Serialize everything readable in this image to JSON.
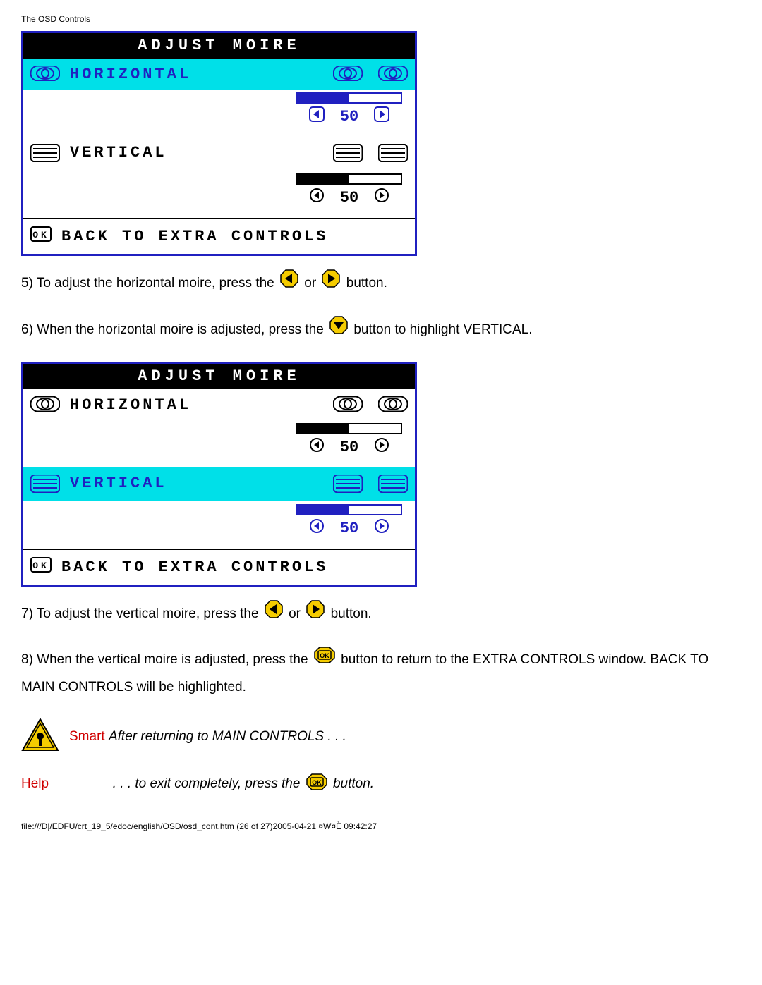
{
  "header": "The OSD Controls",
  "osd": {
    "title": "ADJUST MOIRE",
    "horizontal_label": "HORIZONTAL",
    "vertical_label": "VERTICAL",
    "back_label": "BACK TO EXTRA CONTROLS",
    "box1": {
      "h_value": "50",
      "h_fill": 50,
      "v_value": "50",
      "v_fill": 50
    },
    "box2": {
      "h_value": "50",
      "h_fill": 50,
      "v_value": "50",
      "v_fill": 50
    }
  },
  "steps": {
    "s5a": "5) To adjust the horizontal moire, press the ",
    "s5b": " or ",
    "s5c": " button.",
    "s6a": "6) When the horizontal moire is adjusted, press the ",
    "s6b": " button to highlight VERTICAL.",
    "s7a": "7) To adjust the vertical moire, press the ",
    "s7b": " or ",
    "s7c": " button.",
    "s8a": "8) When the vertical moire is adjusted, press the ",
    "s8b": " button to return to the EXTRA CONTROLS window. BACK TO MAIN CONTROLS will be highlighted."
  },
  "smarthelp": {
    "smart": "Smart",
    "help": "Help",
    "line1": "After returning to MAIN CONTROLS . . .",
    "line2a": ". . . to exit completely, press the ",
    "line2b": " button."
  },
  "footer": "file:///D|/EDFU/crt_19_5/edoc/english/OSD/osd_cont.htm (26 of 27)2005-04-21 ¤W¤È 09:42:27"
}
